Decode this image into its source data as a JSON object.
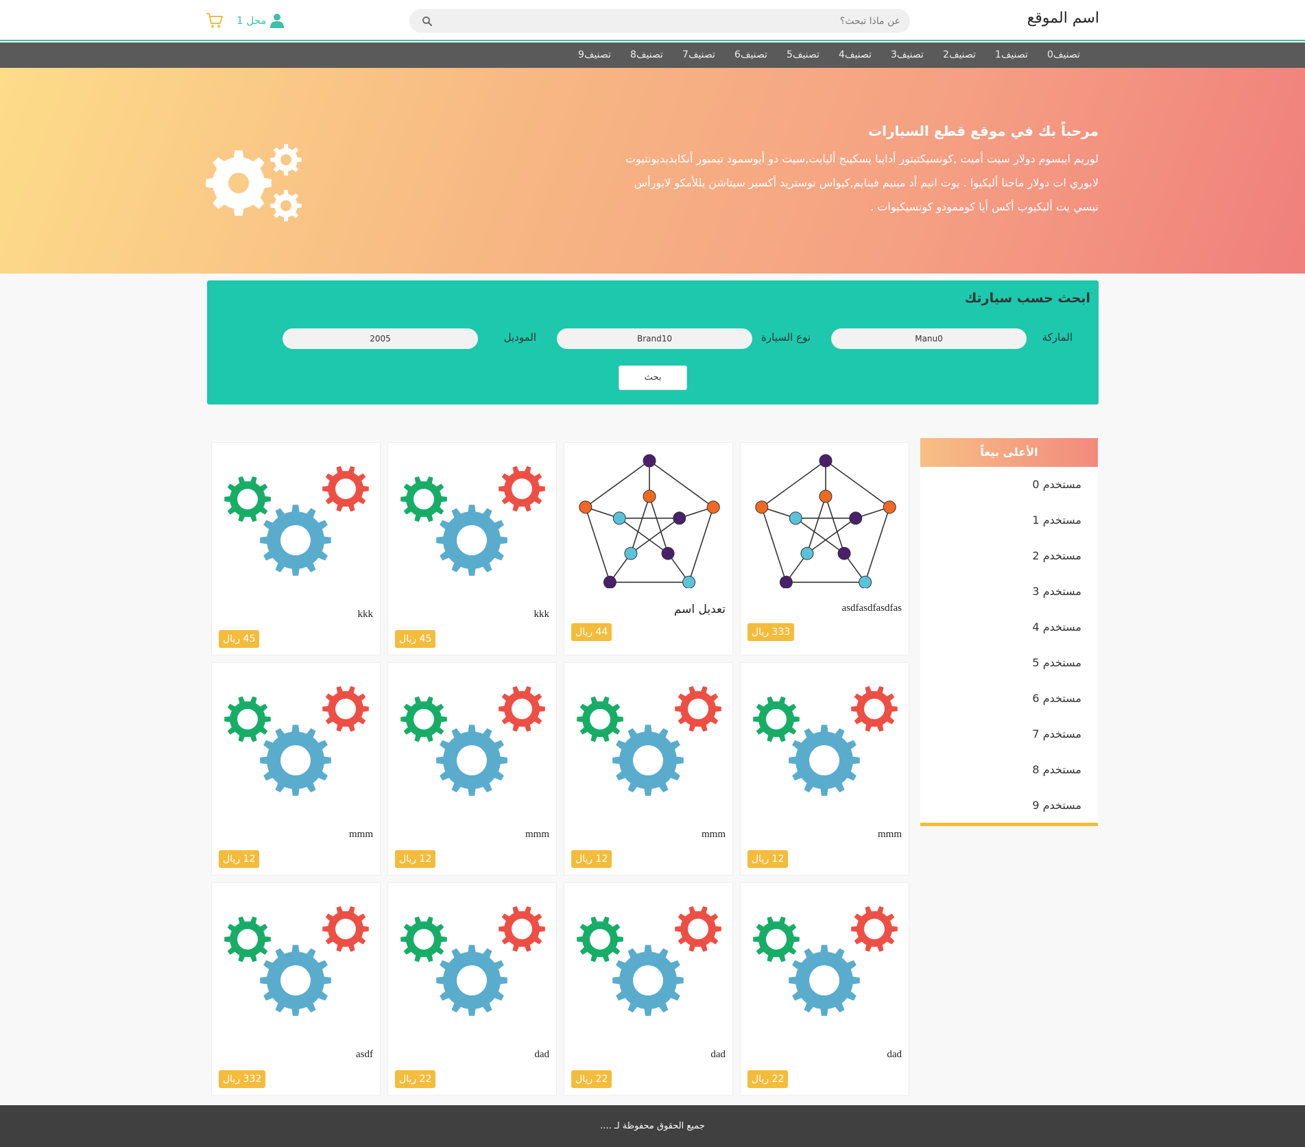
{
  "header": {
    "site_name": "اسم الموقع",
    "search_placeholder": "عن ماذا تبحث؟",
    "user_label": "محل 1"
  },
  "nav": {
    "items": [
      "تصنيف0",
      "تصنيف1",
      "تصنيف2",
      "تصنيف3",
      "تصنيف4",
      "تصنيف5",
      "تصنيف6",
      "تصنيف7",
      "تصنيف8",
      "تصنيف9"
    ]
  },
  "hero": {
    "title": "مرحباً بك في موقع قطع السيارات",
    "text": "لوريم ايبسوم دولار سيت أميت ,كونسيكتيتور أدايبا يسكينج أليايت,سيت دو أيوسمود تيمبور أنكايديديونتيوت لابوري ات دولار ماجنا أليكيوا . يوت انيم أد مينيم فينايم,كيواس نوستريد أكسير سيتاشن يللأمكو لابورأس نيسي يت أليكيوب أكس أيا كوممودو كونسيكيوات ."
  },
  "car_search": {
    "title": "ابحث حسب سيارتك",
    "brand_label": "الماركة",
    "brand_value": "Manu0",
    "type_label": "نوع السيارة",
    "type_value": "Brand10",
    "model_label": "الموديل",
    "model_value": "2005",
    "button_label": "بحث"
  },
  "sidebar": {
    "title": "الأعلى بيعاً",
    "items": [
      "مستخدم 0",
      "مستخدم 1",
      "مستخدم 2",
      "مستخدم 3",
      "مستخدم 4",
      "مستخدم 5",
      "مستخدم 6",
      "مستخدم 7",
      "مستخدم 8",
      "مستخدم 9"
    ]
  },
  "products": [
    {
      "name": "asdfasdfasdfas",
      "price": "333 ريال",
      "image": "graph"
    },
    {
      "name": "تعديل اسم",
      "price": "44 ريال",
      "image": "graph"
    },
    {
      "name": "kkk",
      "price": "45 ريال",
      "image": "gears"
    },
    {
      "name": "kkk",
      "price": "45 ريال",
      "image": "gears"
    },
    {
      "name": "mmm",
      "price": "12 ريال",
      "image": "gears"
    },
    {
      "name": "mmm",
      "price": "12 ريال",
      "image": "gears"
    },
    {
      "name": "mmm",
      "price": "12 ريال",
      "image": "gears"
    },
    {
      "name": "mmm",
      "price": "12 ريال",
      "image": "gears"
    },
    {
      "name": "dad",
      "price": "22 ريال",
      "image": "gears"
    },
    {
      "name": "dad",
      "price": "22 ريال",
      "image": "gears"
    },
    {
      "name": "dad",
      "price": "22 ريال",
      "image": "gears"
    },
    {
      "name": "asdf",
      "price": "332 ريال",
      "image": "gears"
    }
  ],
  "footer": {
    "text": "جميع الحقوق محفوظة لـ ...."
  },
  "colors": {
    "accent": "#1dc8ad",
    "price_badge": "#f4bc3c",
    "nav_bg": "#5a5a5a",
    "footer_bg": "#404040"
  }
}
